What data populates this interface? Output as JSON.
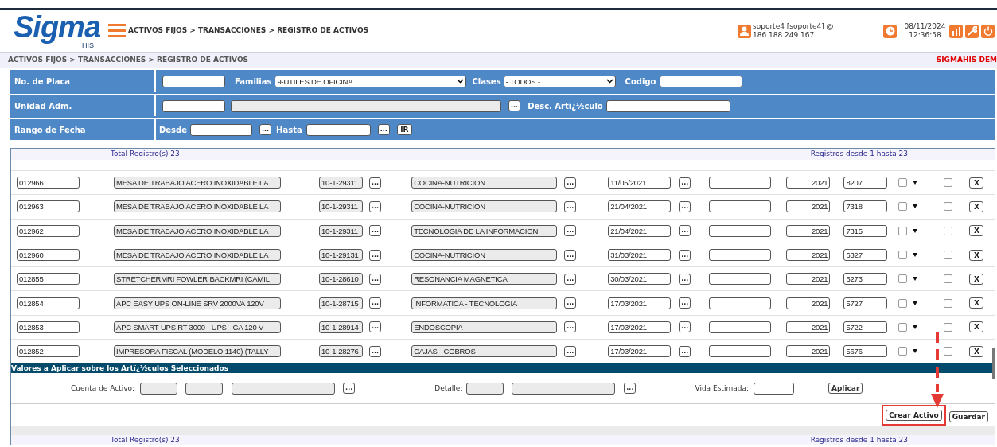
{
  "header": {
    "logo": "Sigma",
    "logo_sub": "HIS",
    "breadcrumb": "ACTIVOS FIJOS > TRANSACCIONES > REGISTRO DE ACTIVOS",
    "user": "soporte4 [soporte4] @",
    "ip": "186.188.249.167",
    "date": "08/11/2024",
    "time": "12:36:58"
  },
  "breadcrumb_bar": {
    "path": "ACTIVOS FIJOS > TRANSACCIONES > REGISTRO DE ACTIVOS",
    "environment": "SIGMAHIS DEM"
  },
  "filters": {
    "placa_label": "No. de Placa",
    "familias_label": "Familias",
    "familias_value": "9-UTILES DE OFICINA",
    "clases_label": "Clases",
    "clases_value": "- TODOS -",
    "codigo_label": "Codigo",
    "unidad_label": "Unidad Adm.",
    "unidad_button": "...",
    "desc_label": "Desc. Artï¿½culo",
    "fecha_label": "Rango de Fecha",
    "desde_label": "Desde",
    "desde_button": "...",
    "hasta_label": "Hasta",
    "hasta_button": "...",
    "ir_button": "IR"
  },
  "table": {
    "total": "Total Registro(s) 23",
    "range": "Registros desde 1 hasta 23",
    "rows": [
      {
        "placa": "012966",
        "descripcion": "MESA DE TRABAJO ACERO INOXIDABLE LA",
        "cuenta": "10-1-29311",
        "cuenta_button": "...",
        "unidad": "COCINA-NUTRICION",
        "unidad_button": "...",
        "fecha": "11/05/2021",
        "fecha_button": "...",
        "anio": "2021",
        "numero": "8207",
        "checked": false,
        "selected": false,
        "delete": "X"
      },
      {
        "placa": "012963",
        "descripcion": "MESA DE TRABAJO ACERO INOXIDABLE LA",
        "cuenta": "10-1-29311",
        "cuenta_button": "...",
        "unidad": "COCINA-NUTRICION",
        "unidad_button": "...",
        "fecha": "21/04/2021",
        "fecha_button": "...",
        "anio": "2021",
        "numero": "7318",
        "checked": false,
        "selected": false,
        "delete": "X"
      },
      {
        "placa": "012962",
        "descripcion": "MESA DE TRABAJO ACERO INOXIDABLE LA",
        "cuenta": "10-1-29311",
        "cuenta_button": "...",
        "unidad": "TECNOLOGIA DE LA INFORMACION",
        "unidad_button": "...",
        "fecha": "21/04/2021",
        "fecha_button": "...",
        "anio": "2021",
        "numero": "7315",
        "checked": false,
        "selected": false,
        "delete": "X"
      },
      {
        "placa": "012960",
        "descripcion": "MESA DE TRABAJO ACERO INOXIDABLE  LA",
        "cuenta": "10-1-29131",
        "cuenta_button": "...",
        "unidad": "COCINA-NUTRICION",
        "unidad_button": "...",
        "fecha": "31/03/2021",
        "fecha_button": "...",
        "anio": "2021",
        "numero": "6327",
        "checked": false,
        "selected": false,
        "delete": "X"
      },
      {
        "placa": "012855",
        "descripcion": "STRETCHERMRI FOWLER BACKMRI (CAMIL",
        "cuenta": "10-1-28610",
        "cuenta_button": "...",
        "unidad": "RESONANCIA MAGNETICA",
        "unidad_button": "...",
        "fecha": "30/03/2021",
        "fecha_button": "...",
        "anio": "2021",
        "numero": "6273",
        "checked": false,
        "selected": false,
        "delete": "X"
      },
      {
        "placa": "012854",
        "descripcion": "APC EASY UPS ON-LINE SRV 2000VA 120V",
        "cuenta": "10-1-28715",
        "cuenta_button": "...",
        "unidad": "INFORMATICA - TECNOLOGIA",
        "unidad_button": "...",
        "fecha": "17/03/2021",
        "fecha_button": "...",
        "anio": "2021",
        "numero": "5727",
        "checked": false,
        "selected": false,
        "delete": "X"
      },
      {
        "placa": "012853",
        "descripcion": "APC SMART-UPS RT 3000 - UPS - CA 120 V",
        "cuenta": "10-1-28914",
        "cuenta_button": "...",
        "unidad": "ENDOSCOPIA",
        "unidad_button": "...",
        "fecha": "17/03/2021",
        "fecha_button": "...",
        "anio": "2021",
        "numero": "5722",
        "checked": false,
        "selected": false,
        "delete": "X"
      },
      {
        "placa": "012852",
        "descripcion": "IMPRESORA FISCAL (MODELO:1140) (TALLY",
        "cuenta": "10-1-28276",
        "cuenta_button": "...",
        "unidad": "CAJAS - COBROS",
        "unidad_button": "...",
        "fecha": "17/03/2021",
        "fecha_button": "...",
        "anio": "2021",
        "numero": "5676",
        "checked": false,
        "selected": false,
        "delete": "X"
      }
    ]
  },
  "apply_panel": {
    "title": "Valores a Aplicar sobre los Artï¿½culos Seleccionados",
    "cuenta_label": "Cuenta de Activo:",
    "cuenta_button": "...",
    "detalle_label": "Detalle:",
    "detalle_button": "...",
    "vida_label": "Vida Estimada:",
    "apply_button": "Aplicar"
  },
  "actions": [
    {
      "label": "Crear Activo",
      "highlighted": true
    },
    {
      "label": "Guardar",
      "highlighted": false
    }
  ],
  "footer": {
    "total": "Total Registro(s) 23",
    "range": "Registros desde 1 hasta 23"
  }
}
